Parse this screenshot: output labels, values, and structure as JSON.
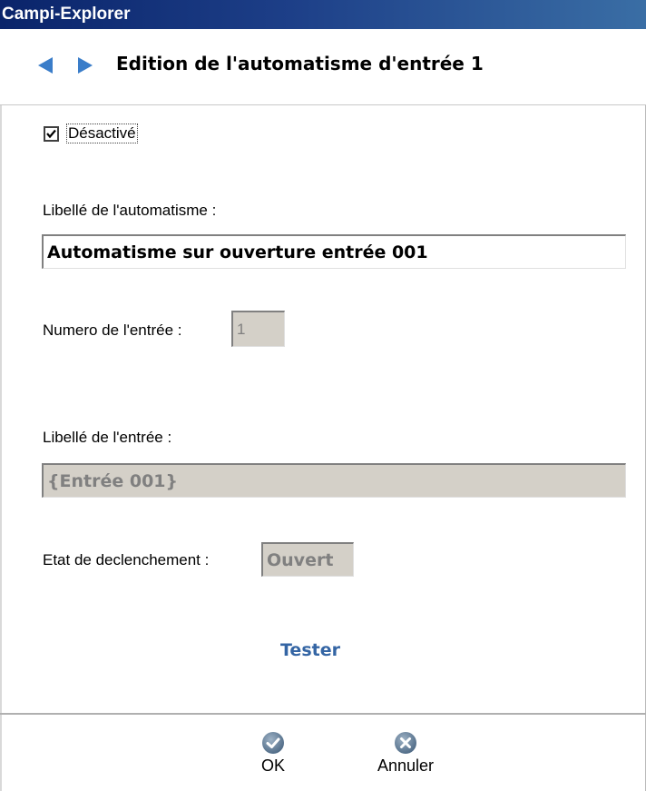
{
  "window": {
    "title": "Campi-Explorer"
  },
  "header": {
    "title": "Edition de l'automatisme d'entrée 1",
    "back_icon": "arrow-left-icon",
    "forward_icon": "arrow-right-icon",
    "accent_color": "#3a7dc9"
  },
  "form": {
    "disabled_checkbox": {
      "label": "Désactivé",
      "checked": true
    },
    "automatisme_label": "Libellé de l'automatisme :",
    "automatisme_value": "Automatisme sur ouverture entrée 001",
    "numero_label": "Numero de l'entrée :",
    "numero_value": "1",
    "libelle_entree_label": "Libellé de l'entrée :",
    "libelle_entree_value": "{Entrée 001}",
    "etat_label": "Etat de declenchement :",
    "etat_value": "Ouvert",
    "tester_label": "Tester"
  },
  "footer": {
    "ok_label": "OK",
    "ok_icon": "check-circle-icon",
    "cancel_label": "Annuler",
    "cancel_icon": "close-circle-icon"
  }
}
